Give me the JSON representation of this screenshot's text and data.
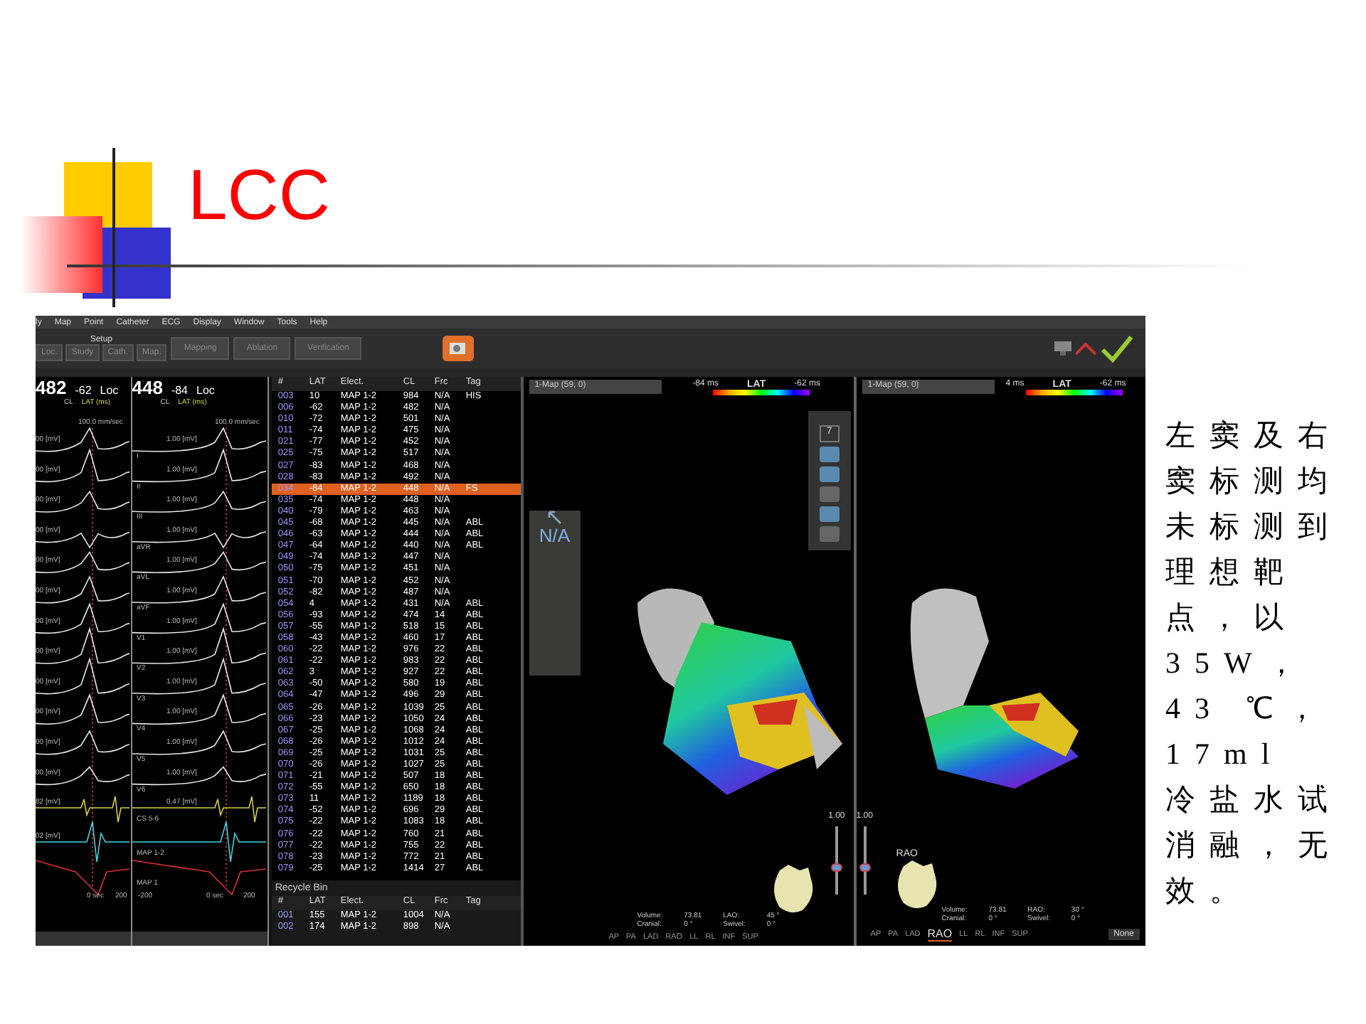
{
  "slide": {
    "title": "LCC",
    "note": "左窦及右窦标测均未标测到理想靶点，以 35W，43 ℃，17ml 冷盐水试消融，无效。"
  },
  "menu": [
    "ly",
    "Map",
    "Point",
    "Catheter",
    "ECG",
    "Display",
    "Window",
    "Tools",
    "Help"
  ],
  "toolbar": {
    "setup_label": "Setup",
    "setup_buttons": [
      "Loc.",
      "Study",
      "Cath.",
      "Map."
    ],
    "stage_buttons": [
      "Mapping",
      "Ablation",
      "Verification"
    ]
  },
  "ecg_panels": [
    {
      "cl": "482",
      "lat": "-62",
      "loc": "Loc",
      "cl_label": "CL",
      "lat_label": "LAT (ms)",
      "speed": "100.0 mm/sec",
      "time_labels": [
        "0 sec",
        "200"
      ],
      "leads": [
        {
          "scale": "00 [mV]",
          "color": "#e8e8e8"
        },
        {
          "scale": "00 [mV]",
          "color": "#e8e8e8"
        },
        {
          "scale": "00 [mV]",
          "color": "#e8e8e8"
        },
        {
          "scale": "00 [mV]",
          "color": "#e8e8e8"
        },
        {
          "scale": "00 [mV]",
          "color": "#e8e8e8"
        },
        {
          "scale": "00 [mV]",
          "color": "#e8e8e8"
        },
        {
          "scale": "00 [mV]",
          "color": "#e8e8e8"
        },
        {
          "scale": "00 [mV]",
          "color": "#e8e8e8"
        },
        {
          "scale": "00 [mV]",
          "color": "#e8e8e8"
        },
        {
          "scale": "00 [mV]",
          "color": "#e8e8e8"
        },
        {
          "scale": "00 [mV]",
          "color": "#e8e8e8"
        },
        {
          "scale": "00 [mV]",
          "color": "#e8e8e8"
        },
        {
          "scale": "82 [mV]",
          "color": "#d8d040"
        },
        {
          "scale": "02 [mV]",
          "color": "#40d8e0"
        },
        {
          "color": "#d83030"
        }
      ]
    },
    {
      "cl": "448",
      "lat": "-84",
      "loc": "Loc",
      "cl_label": "CL",
      "lat_label": "LAT (ms)",
      "speed": "100.0 mm/sec",
      "time_labels": [
        "-200",
        "0 sec",
        "200"
      ],
      "leads": [
        {
          "label": "I",
          "scale": "1.00 [mV]",
          "color": "#e8e8e8"
        },
        {
          "label": "II",
          "scale": "1.00 [mV]",
          "color": "#e8e8e8"
        },
        {
          "label": "III",
          "scale": "1.00 [mV]",
          "color": "#e8e8e8"
        },
        {
          "label": "aVR",
          "scale": "1.00 [mV]",
          "color": "#e8e8e8"
        },
        {
          "label": "aVL",
          "scale": "1.00 [mV]",
          "color": "#e8e8e8"
        },
        {
          "label": "aVF",
          "scale": "1.00 [mV]",
          "color": "#e8e8e8"
        },
        {
          "label": "V1",
          "scale": "1.00 [mV]",
          "color": "#e8e8e8"
        },
        {
          "label": "V2",
          "scale": "1.00 [mV]",
          "color": "#e8e8e8"
        },
        {
          "label": "V3",
          "scale": "1.00 [mV]",
          "color": "#e8e8e8"
        },
        {
          "label": "V4",
          "scale": "1.00 [mV]",
          "color": "#e8e8e8"
        },
        {
          "label": "V5",
          "scale": "1.00 [mV]",
          "color": "#e8e8e8"
        },
        {
          "label": "V6",
          "scale": "1.00 [mV]",
          "color": "#e8e8e8"
        },
        {
          "label": "CS 5-6",
          "scale": "0.47 [mV]",
          "color": "#d8d040"
        },
        {
          "label": "MAP 1-2",
          "color": "#40d8e0"
        },
        {
          "label": "MAP 1",
          "color": "#d83030"
        }
      ]
    }
  ],
  "points_table": {
    "columns": [
      "#",
      "LAT",
      "Elect.",
      "CL",
      "Frc",
      "Tag"
    ],
    "rows": [
      {
        "cells": [
          "003",
          "10",
          "MAP 1-2",
          "984",
          "N/A",
          "HIS"
        ],
        "selected": false
      },
      {
        "cells": [
          "006",
          "-62",
          "MAP 1-2",
          "482",
          "N/A"
        ],
        "selected": false
      },
      {
        "cells": [
          "010",
          "-72",
          "MAP 1-2",
          "501",
          "N/A"
        ],
        "selected": false
      },
      {
        "cells": [
          "011",
          "-74",
          "MAP 1-2",
          "475",
          "N/A"
        ],
        "selected": false
      },
      {
        "cells": [
          "021",
          "-77",
          "MAP 1-2",
          "452",
          "N/A"
        ],
        "selected": false
      },
      {
        "cells": [
          "025",
          "-75",
          "MAP 1-2",
          "517",
          "N/A"
        ],
        "selected": false
      },
      {
        "cells": [
          "027",
          "-83",
          "MAP 1-2",
          "468",
          "N/A"
        ],
        "selected": false
      },
      {
        "cells": [
          "028",
          "-83",
          "MAP 1-2",
          "492",
          "N/A"
        ],
        "selected": false
      },
      {
        "cells": [
          "034",
          "-84",
          "MAP 1-2",
          "448",
          "N/A",
          "FS"
        ],
        "selected": true
      },
      {
        "cells": [
          "035",
          "-74",
          "MAP 1-2",
          "448",
          "N/A"
        ],
        "selected": false
      },
      {
        "cells": [
          "040",
          "-79",
          "MAP 1-2",
          "463",
          "N/A"
        ],
        "selected": false
      },
      {
        "cells": [
          "045",
          "-68",
          "MAP 1-2",
          "445",
          "N/A",
          "ABL"
        ],
        "selected": false
      },
      {
        "cells": [
          "046",
          "-63",
          "MAP 1-2",
          "444",
          "N/A",
          "ABL"
        ],
        "selected": false
      },
      {
        "cells": [
          "047",
          "-64",
          "MAP 1-2",
          "440",
          "N/A",
          "ABL"
        ],
        "selected": false
      },
      {
        "cells": [
          "049",
          "-74",
          "MAP 1-2",
          "447",
          "N/A"
        ],
        "selected": false
      },
      {
        "cells": [
          "050",
          "-75",
          "MAP 1-2",
          "451",
          "N/A"
        ],
        "selected": false
      },
      {
        "cells": [
          "051",
          "-70",
          "MAP 1-2",
          "452",
          "N/A"
        ],
        "selected": false
      },
      {
        "cells": [
          "052",
          "-82",
          "MAP 1-2",
          "487",
          "N/A"
        ],
        "selected": false
      },
      {
        "cells": [
          "054",
          "4",
          "MAP 1-2",
          "431",
          "N/A",
          "ABL"
        ],
        "selected": false
      },
      {
        "cells": [
          "056",
          "-93",
          "MAP 1-2",
          "474",
          "14",
          "ABL"
        ],
        "selected": false
      },
      {
        "cells": [
          "057",
          "-55",
          "MAP 1-2",
          "518",
          "15",
          "ABL"
        ],
        "selected": false
      },
      {
        "cells": [
          "058",
          "-43",
          "MAP 1-2",
          "460",
          "17",
          "ABL"
        ],
        "selected": false
      },
      {
        "cells": [
          "060",
          "-22",
          "MAP 1-2",
          "976",
          "22",
          "ABL"
        ],
        "selected": false
      },
      {
        "cells": [
          "061",
          "-22",
          "MAP 1-2",
          "983",
          "22",
          "ABL"
        ],
        "selected": false
      },
      {
        "cells": [
          "062",
          "3",
          "MAP 1-2",
          "927",
          "22",
          "ABL"
        ],
        "selected": false
      },
      {
        "cells": [
          "063",
          "-50",
          "MAP 1-2",
          "580",
          "19",
          "ABL"
        ],
        "selected": false
      },
      {
        "cells": [
          "064",
          "-47",
          "MAP 1-2",
          "496",
          "29",
          "ABL"
        ],
        "selected": false
      },
      {
        "cells": [
          "065",
          "-26",
          "MAP 1-2",
          "1039",
          "25",
          "ABL"
        ],
        "selected": false
      },
      {
        "cells": [
          "066",
          "-23",
          "MAP 1-2",
          "1050",
          "24",
          "ABL"
        ],
        "selected": false
      },
      {
        "cells": [
          "067",
          "-25",
          "MAP 1-2",
          "1068",
          "24",
          "ABL"
        ],
        "selected": false
      },
      {
        "cells": [
          "068",
          "-26",
          "MAP 1-2",
          "1012",
          "24",
          "ABL"
        ],
        "selected": false
      },
      {
        "cells": [
          "069",
          "-25",
          "MAP 1-2",
          "1031",
          "25",
          "ABL"
        ],
        "selected": false
      },
      {
        "cells": [
          "070",
          "-26",
          "MAP 1-2",
          "1027",
          "25",
          "ABL"
        ],
        "selected": false
      },
      {
        "cells": [
          "071",
          "-21",
          "MAP 1-2",
          "507",
          "18",
          "ABL"
        ],
        "selected": false
      },
      {
        "cells": [
          "072",
          "-55",
          "MAP 1-2",
          "650",
          "18",
          "ABL"
        ],
        "selected": false
      },
      {
        "cells": [
          "073",
          "11",
          "MAP 1-2",
          "1189",
          "18",
          "ABL"
        ],
        "selected": false
      },
      {
        "cells": [
          "074",
          "-52",
          "MAP 1-2",
          "696",
          "29",
          "ABL"
        ],
        "selected": false
      },
      {
        "cells": [
          "075",
          "-22",
          "MAP 1-2",
          "1083",
          "18",
          "ABL"
        ],
        "selected": false
      },
      {
        "cells": [
          "076",
          "-22",
          "MAP 1-2",
          "760",
          "21",
          "ABL"
        ],
        "selected": false
      },
      {
        "cells": [
          "077",
          "-22",
          "MAP 1-2",
          "755",
          "22",
          "ABL"
        ],
        "selected": false
      },
      {
        "cells": [
          "078",
          "-23",
          "MAP 1-2",
          "772",
          "21",
          "ABL"
        ],
        "selected": false
      },
      {
        "cells": [
          "079",
          "-25",
          "MAP 1-2",
          "1414",
          "27",
          "ABL"
        ],
        "selected": false
      }
    ]
  },
  "recycle_bin": {
    "title": "Recycle Bin",
    "columns": [
      "#",
      "LAT",
      "Elect.",
      "CL",
      "Frc",
      "Tag"
    ],
    "rows": [
      {
        "cells": [
          "001",
          "155",
          "MAP 1-2",
          "1004",
          "N/A"
        ]
      },
      {
        "cells": [
          "002",
          "174",
          "MAP 1-2",
          "898",
          "N/A"
        ]
      }
    ]
  },
  "map_panels": [
    {
      "map_select": "1-Map (59, 0)",
      "legend_min": "-84 ms",
      "legend_title": "LAT",
      "legend_max": "-62 ms",
      "na_panel": "N/A",
      "tool_count": "7",
      "zoom_value": "1.00",
      "zoom": {
        "level": 0.4
      },
      "info": [
        {
          "label": "Volume:",
          "value": "73.81"
        },
        {
          "label": "LAO:",
          "value": "45 °"
        },
        {
          "label": "Cranial:",
          "value": "0 °"
        },
        {
          "label": "Swivel:",
          "value": "0 °"
        }
      ],
      "views": [
        {
          "label": "AP",
          "selected": false
        },
        {
          "label": "PA",
          "selected": false
        },
        {
          "label": "LAD",
          "selected": false
        },
        {
          "label": "RAO",
          "selected": false
        },
        {
          "label": "LL",
          "selected": false
        },
        {
          "label": "RL",
          "selected": false
        },
        {
          "label": "INF",
          "selected": false
        },
        {
          "label": "SUP",
          "selected": false
        }
      ]
    },
    {
      "map_select": "1-Map (59, 0)",
      "legend_min": "4 ms",
      "legend_title": "LAT",
      "legend_max": "-62 ms",
      "orientation_label": "RAO",
      "zoom_value": "1.00",
      "zoom": {
        "level": 0.4
      },
      "display_select": "None",
      "info": [
        {
          "label": "Volume:",
          "value": "73.81"
        },
        {
          "label": "RAO:",
          "value": "30 °"
        },
        {
          "label": "Cranial:",
          "value": "0 °"
        },
        {
          "label": "Swivel:",
          "value": "0 °"
        }
      ],
      "views": [
        {
          "label": "AP",
          "selected": false
        },
        {
          "label": "PA",
          "selected": false
        },
        {
          "label": "LAD",
          "selected": false
        },
        {
          "label": "RAO",
          "selected": true
        },
        {
          "label": "LL",
          "selected": false
        },
        {
          "label": "RL",
          "selected": false
        },
        {
          "label": "INF",
          "selected": false
        },
        {
          "label": "SUP",
          "selected": false
        }
      ]
    }
  ]
}
